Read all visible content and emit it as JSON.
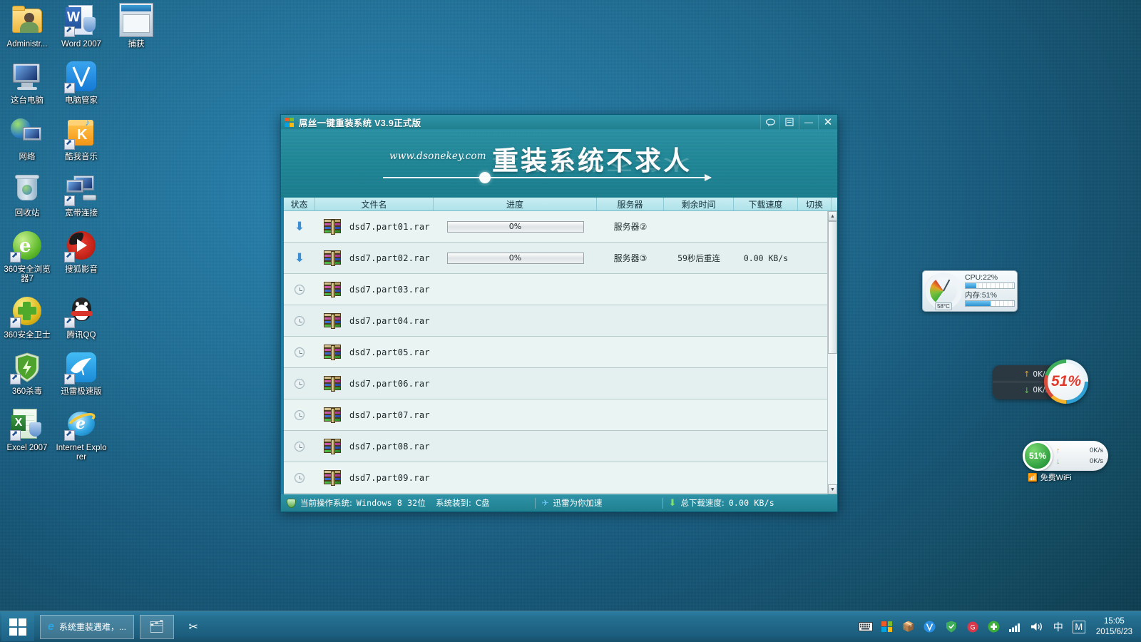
{
  "desktop": {
    "icons": [
      {
        "label": "Administr...",
        "icon": "user-folder-icon",
        "shortcut": false
      },
      {
        "label": "Word 2007",
        "icon": "word-icon",
        "shortcut": true
      },
      {
        "label": "这台电脑",
        "icon": "this-pc-icon",
        "shortcut": false
      },
      {
        "label": "电脑管家",
        "icon": "pc-manager-icon",
        "shortcut": true
      },
      {
        "label": "网络",
        "icon": "network-icon",
        "shortcut": false
      },
      {
        "label": "酷我音乐",
        "icon": "kuwo-music-icon",
        "shortcut": true
      },
      {
        "label": "回收站",
        "icon": "recycle-bin-icon",
        "shortcut": false
      },
      {
        "label": "宽带连接",
        "icon": "broadband-connection-icon",
        "shortcut": true
      },
      {
        "label": "360安全浏览器7",
        "icon": "360-browser-icon",
        "shortcut": true
      },
      {
        "label": "搜狐影音",
        "icon": "sohu-video-icon",
        "shortcut": true
      },
      {
        "label": "360安全卫士",
        "icon": "360-safeguard-icon",
        "shortcut": true
      },
      {
        "label": "腾讯QQ",
        "icon": "qq-icon",
        "shortcut": true
      },
      {
        "label": "360杀毒",
        "icon": "360-antivirus-icon",
        "shortcut": true
      },
      {
        "label": "迅雷极速版",
        "icon": "thunder-icon",
        "shortcut": true
      },
      {
        "label": "Excel 2007",
        "icon": "excel-icon",
        "shortcut": true
      },
      {
        "label": "Internet Explorer",
        "icon": "ie-icon",
        "shortcut": true
      }
    ],
    "capture_icon_label": "捕获"
  },
  "window": {
    "title": "屌丝一键重装系统  V3.9正式版",
    "buttons": {
      "feedback": "speech-bubble-icon",
      "form": "form-icon",
      "minimize": "—",
      "close": "✕"
    },
    "banner": {
      "site": "www.dsonekey.com",
      "slogan": "重装系统不求人"
    },
    "table": {
      "columns": [
        "状态",
        "文件名",
        "进度",
        "服务器",
        "剩余时间",
        "下载速度",
        "切换"
      ],
      "rows": [
        {
          "status": "downloading",
          "filename": "dsd7.part01.rar",
          "progress": "0%",
          "progress_value": 0,
          "server": "服务器②",
          "remaining": "",
          "speed": "",
          "switch": ""
        },
        {
          "status": "downloading",
          "filename": "dsd7.part02.rar",
          "progress": "0%",
          "progress_value": 0,
          "server": "服务器③",
          "remaining": "59秒后重连",
          "speed": "0.00 KB/s",
          "switch": ""
        },
        {
          "status": "waiting",
          "filename": "dsd7.part03.rar",
          "progress": "",
          "progress_value": null,
          "server": "",
          "remaining": "",
          "speed": "",
          "switch": ""
        },
        {
          "status": "waiting",
          "filename": "dsd7.part04.rar",
          "progress": "",
          "progress_value": null,
          "server": "",
          "remaining": "",
          "speed": "",
          "switch": ""
        },
        {
          "status": "waiting",
          "filename": "dsd7.part05.rar",
          "progress": "",
          "progress_value": null,
          "server": "",
          "remaining": "",
          "speed": "",
          "switch": ""
        },
        {
          "status": "waiting",
          "filename": "dsd7.part06.rar",
          "progress": "",
          "progress_value": null,
          "server": "",
          "remaining": "",
          "speed": "",
          "switch": ""
        },
        {
          "status": "waiting",
          "filename": "dsd7.part07.rar",
          "progress": "",
          "progress_value": null,
          "server": "",
          "remaining": "",
          "speed": "",
          "switch": ""
        },
        {
          "status": "waiting",
          "filename": "dsd7.part08.rar",
          "progress": "",
          "progress_value": null,
          "server": "",
          "remaining": "",
          "speed": "",
          "switch": ""
        },
        {
          "status": "waiting",
          "filename": "dsd7.part09.rar",
          "progress": "",
          "progress_value": null,
          "server": "",
          "remaining": "",
          "speed": "",
          "switch": ""
        }
      ]
    },
    "statusbar": {
      "os_label": "当前操作系统:",
      "os_value": "Windows 8 32位",
      "install_label": "系统装到:",
      "install_value": "C盘",
      "accel": "迅雷为你加速",
      "total_speed_label": "总下载速度:",
      "total_speed_value": "0.00 KB/s"
    }
  },
  "gadgets": {
    "cpu": {
      "cpu_label": "CPU:22%",
      "mem_label": "内存:51%",
      "temp": "58°C",
      "cpu_pct": 22,
      "mem_pct": 51
    },
    "net": {
      "up": "0K/s",
      "down": "0K/s"
    },
    "ball": {
      "value": "51%"
    },
    "safe": {
      "pct": "51%",
      "up": "0K/s",
      "down": "0K/s",
      "wifi": "免费WiFi"
    }
  },
  "taskbar": {
    "start": "start-button",
    "tasks": [
      {
        "label": "系统重装遇难，...",
        "icon": "ie-icon"
      },
      {
        "label": "",
        "icon": "file-explorer-icon"
      },
      {
        "label": "",
        "icon": "snipping-tool-icon"
      }
    ],
    "tray": [
      "keyboard-icon",
      "windows-icon",
      "kuwo-icon",
      "pc-manager-icon",
      "360-shield-icon",
      "recorder-icon",
      "360-safeguard-icon",
      "signal-icon",
      "volume-icon",
      "ime-chinese-icon",
      "ime-m-icon"
    ],
    "ime_cn": "中",
    "ime_m": "M",
    "time": "15:05",
    "date": "2015/6/23"
  },
  "colors": {
    "accent": "#1f808f",
    "window_bg": "#e6f2f1",
    "header_row": "#aee2ea",
    "taskbar": "#1c5d7c"
  }
}
